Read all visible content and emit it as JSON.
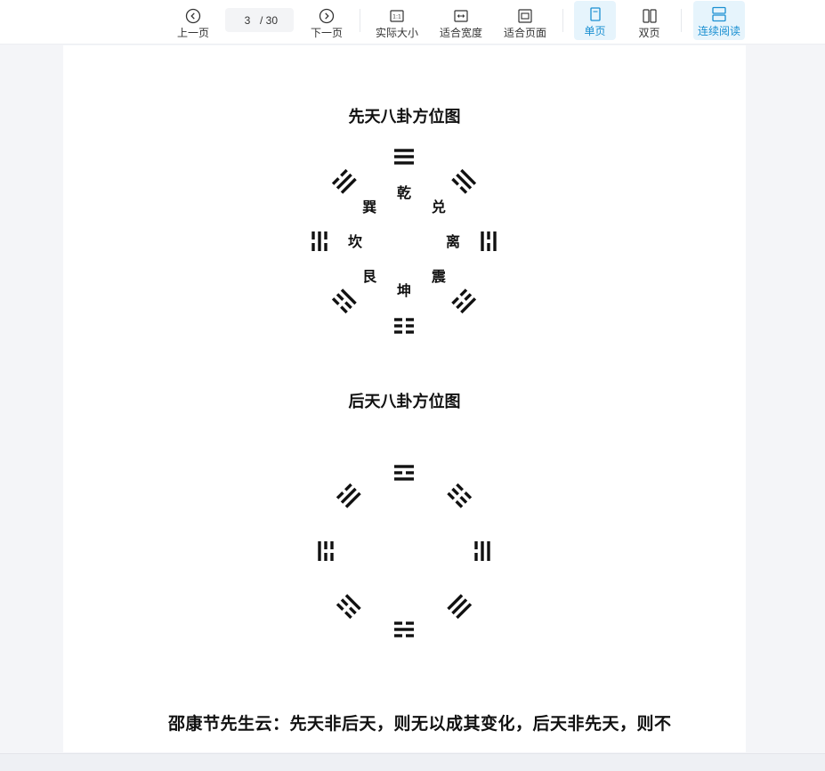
{
  "toolbar": {
    "prev_label": "上一页",
    "next_label": "下一页",
    "current_page": "3",
    "total_pages": "/ 30",
    "actual_size_label": "实际大小",
    "fit_width_label": "适合宽度",
    "fit_page_label": "适合页面",
    "single_page_label": "单页",
    "double_page_label": "双页",
    "continuous_label": "连续阅读",
    "active_color": "#1a8fd1"
  },
  "document": {
    "title1": "先天八卦方位图",
    "title2": "后天八卦方位图",
    "bagua1": {
      "inner": [
        "乾",
        "兑",
        "离",
        "震",
        "坤",
        "艮",
        "坎",
        "巽"
      ],
      "trigrams": [
        "111",
        "110",
        "101",
        "100",
        "000",
        "001",
        "010",
        "011"
      ]
    },
    "bagua2": {
      "trigrams": [
        "101",
        "000",
        "110",
        "111",
        "010",
        "001",
        "100",
        "011"
      ]
    },
    "body_text": "邵康节先生云：先天非后天，则无以成其变化，后天非先天，则不"
  }
}
